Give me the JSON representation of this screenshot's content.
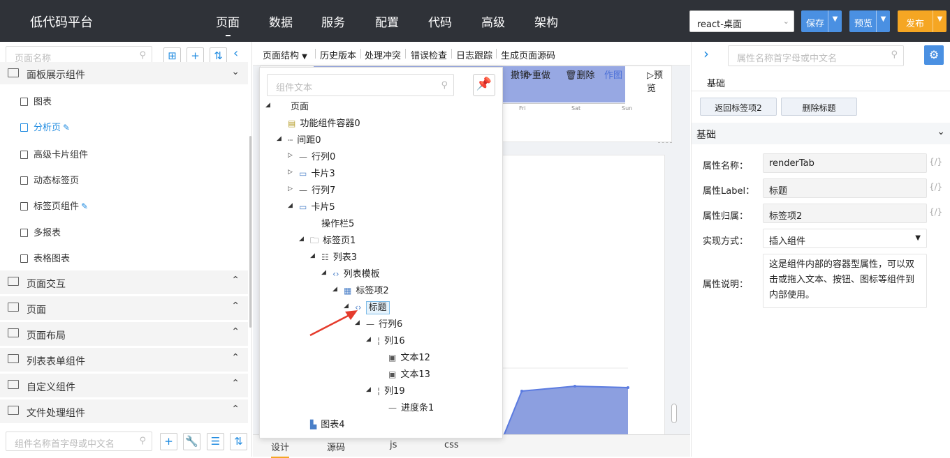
{
  "header": {
    "brand": "低代码平台",
    "nav": [
      "页面",
      "数据",
      "服务",
      "配置",
      "代码",
      "高级",
      "架构"
    ],
    "env_select": "react-桌面",
    "save_label": "保存",
    "preview_label": "预览",
    "publish_label": "发布",
    "colors": {
      "bar": "#2f3238",
      "save": "#4a90e2",
      "publish": "#f5a623"
    }
  },
  "left": {
    "search_placeholder": "页面名称",
    "groups": [
      {
        "label": "面板展示组件",
        "expanded": true,
        "items": [
          {
            "label": "图表"
          },
          {
            "label": "分析页",
            "active": true,
            "editable": true
          },
          {
            "label": "高级卡片组件"
          },
          {
            "label": "动态标签页"
          },
          {
            "label": "标签页组件",
            "editable": true
          },
          {
            "label": "多报表"
          },
          {
            "label": "表格图表"
          }
        ]
      },
      {
        "label": "页面交互",
        "expanded": false
      },
      {
        "label": "页面",
        "expanded": false
      },
      {
        "label": "页面布局",
        "expanded": false
      },
      {
        "label": "列表表单组件",
        "expanded": false
      },
      {
        "label": "自定义组件",
        "expanded": false
      },
      {
        "label": "文件处理组件",
        "expanded": false
      }
    ],
    "bottom_search_placeholder": "组件名称首字母或中文名"
  },
  "toolbar": {
    "items": [
      "页面结构",
      "历史版本",
      "处理冲突",
      "错误检查",
      "日志跟踪",
      "生成页面源码"
    ]
  },
  "canvas": {
    "actions": [
      "撤销",
      "重做",
      "删除",
      "作图",
      "预览"
    ],
    "axis_days": [
      "Fri",
      "Sat",
      "Sun"
    ]
  },
  "bottom_tabs": [
    "设计",
    "源码",
    "js",
    "css"
  ],
  "tree": {
    "search_placeholder": "组件文本",
    "nodes": [
      {
        "label": "页面",
        "depth": 0,
        "icon": "",
        "toggle": "▲"
      },
      {
        "label": "功能组件容器0",
        "depth": 1,
        "icon": "db",
        "toggle": ""
      },
      {
        "label": "间距0",
        "depth": 1,
        "icon": "spacer",
        "toggle": "▲"
      },
      {
        "label": "行列0",
        "depth": 2,
        "icon": "row",
        "toggle": "▷"
      },
      {
        "label": "卡片3",
        "depth": 2,
        "icon": "card",
        "toggle": "▷"
      },
      {
        "label": "行列7",
        "depth": 2,
        "icon": "row",
        "toggle": "▷"
      },
      {
        "label": "卡片5",
        "depth": 2,
        "icon": "card",
        "toggle": "▲"
      },
      {
        "label": "操作栏5",
        "depth": 3,
        "icon": "",
        "toggle": ""
      },
      {
        "label": "标签页1",
        "depth": 3,
        "icon": "folder",
        "toggle": "▲"
      },
      {
        "label": "列表3",
        "depth": 4,
        "icon": "list",
        "toggle": "▲"
      },
      {
        "label": "列表模板",
        "depth": 5,
        "icon": "code",
        "toggle": "▲"
      },
      {
        "label": "标签项2",
        "depth": 6,
        "icon": "tabitem",
        "toggle": "▲"
      },
      {
        "label": "标题",
        "depth": 7,
        "icon": "code",
        "toggle": "▲",
        "selected": true
      },
      {
        "label": "行列6",
        "depth": 8,
        "icon": "row",
        "toggle": "▲"
      },
      {
        "label": "列16",
        "depth": 9,
        "icon": "col",
        "toggle": "▲"
      },
      {
        "label": "文本12",
        "depth": 10,
        "icon": "text",
        "toggle": ""
      },
      {
        "label": "文本13",
        "depth": 10,
        "icon": "text",
        "toggle": ""
      },
      {
        "label": "列19",
        "depth": 9,
        "icon": "col",
        "toggle": "▲"
      },
      {
        "label": "进度条1",
        "depth": 10,
        "icon": "dash",
        "toggle": ""
      },
      {
        "label": "图表4",
        "depth": 3,
        "icon": "chart",
        "toggle": ""
      }
    ]
  },
  "right": {
    "search_placeholder": "属性名称首字母或中文名",
    "tab_label": "基础",
    "btn_back": "返回标签项2",
    "btn_delete": "删除标题",
    "section": "基础",
    "props": [
      {
        "label": "属性名称：",
        "value": "renderTab"
      },
      {
        "label": "属性Label：",
        "value": "标题"
      },
      {
        "label": "属性归属：",
        "value": "标签项2"
      }
    ],
    "impl_label": "实现方式：",
    "impl_value": "插入组件",
    "desc_label": "属性说明：",
    "desc_value": "这是组件内部的容器型属性，可以双击或拖入文本、按钮、图标等组件到内部使用。",
    "brace": "{/}"
  }
}
